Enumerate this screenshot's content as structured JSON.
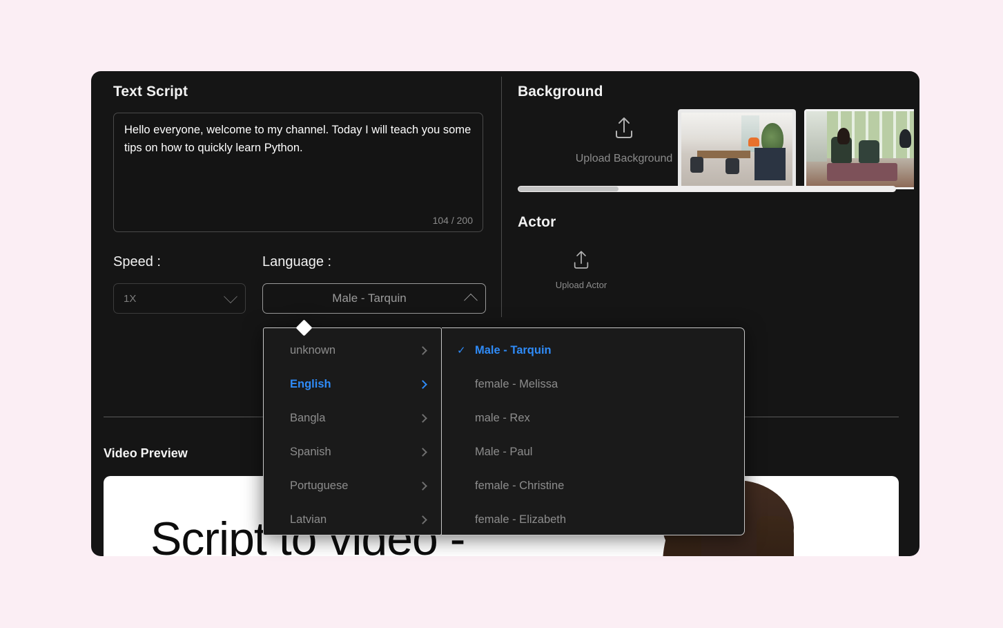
{
  "theme": {
    "page_background": "#fbeef4",
    "card_background": "#151515",
    "accent": "#2f8bf7",
    "muted_text": "#8d8d8d",
    "primary_text": "#f2f2f2"
  },
  "left_panel": {
    "text_script": {
      "title": "Text Script",
      "value": "Hello everyone, welcome to my channel. Today I will teach you some tips on how to quickly learn Python.",
      "counter": "104 / 200"
    },
    "speed": {
      "label": "Speed :",
      "value": "1X",
      "chevron": "chevron-down-icon"
    },
    "language": {
      "label": "Language :",
      "value": "Male - Tarquin",
      "chevron": "chevron-up-icon"
    }
  },
  "right_panel": {
    "background": {
      "title": "Background",
      "upload_label": "Upload Background",
      "upload_icon": "upload-icon",
      "thumbnails": [
        {
          "name": "office-desks-thumbnail",
          "selected": true
        },
        {
          "name": "meeting-lounge-thumbnail",
          "selected": false
        }
      ]
    },
    "actor": {
      "title": "Actor",
      "upload_label": "Upload Actor",
      "upload_icon": "upload-icon"
    }
  },
  "video_preview": {
    "title": "Video Preview",
    "headline": "Script to video -"
  },
  "voice_dropdown": {
    "languages": [
      {
        "label": "unknown",
        "selected": false
      },
      {
        "label": "English",
        "selected": true
      },
      {
        "label": "Bangla",
        "selected": false
      },
      {
        "label": "Spanish",
        "selected": false
      },
      {
        "label": "Portuguese",
        "selected": false
      },
      {
        "label": "Latvian",
        "selected": false
      }
    ],
    "voices": [
      {
        "label": "Male - Tarquin",
        "selected": true
      },
      {
        "label": "female - Melissa",
        "selected": false
      },
      {
        "label": "male - Rex",
        "selected": false
      },
      {
        "label": "Male - Paul",
        "selected": false
      },
      {
        "label": "female - Christine",
        "selected": false
      },
      {
        "label": "female - Elizabeth",
        "selected": false
      }
    ],
    "check_icon": "✓",
    "submenu_icon": "chevron-right-icon"
  }
}
